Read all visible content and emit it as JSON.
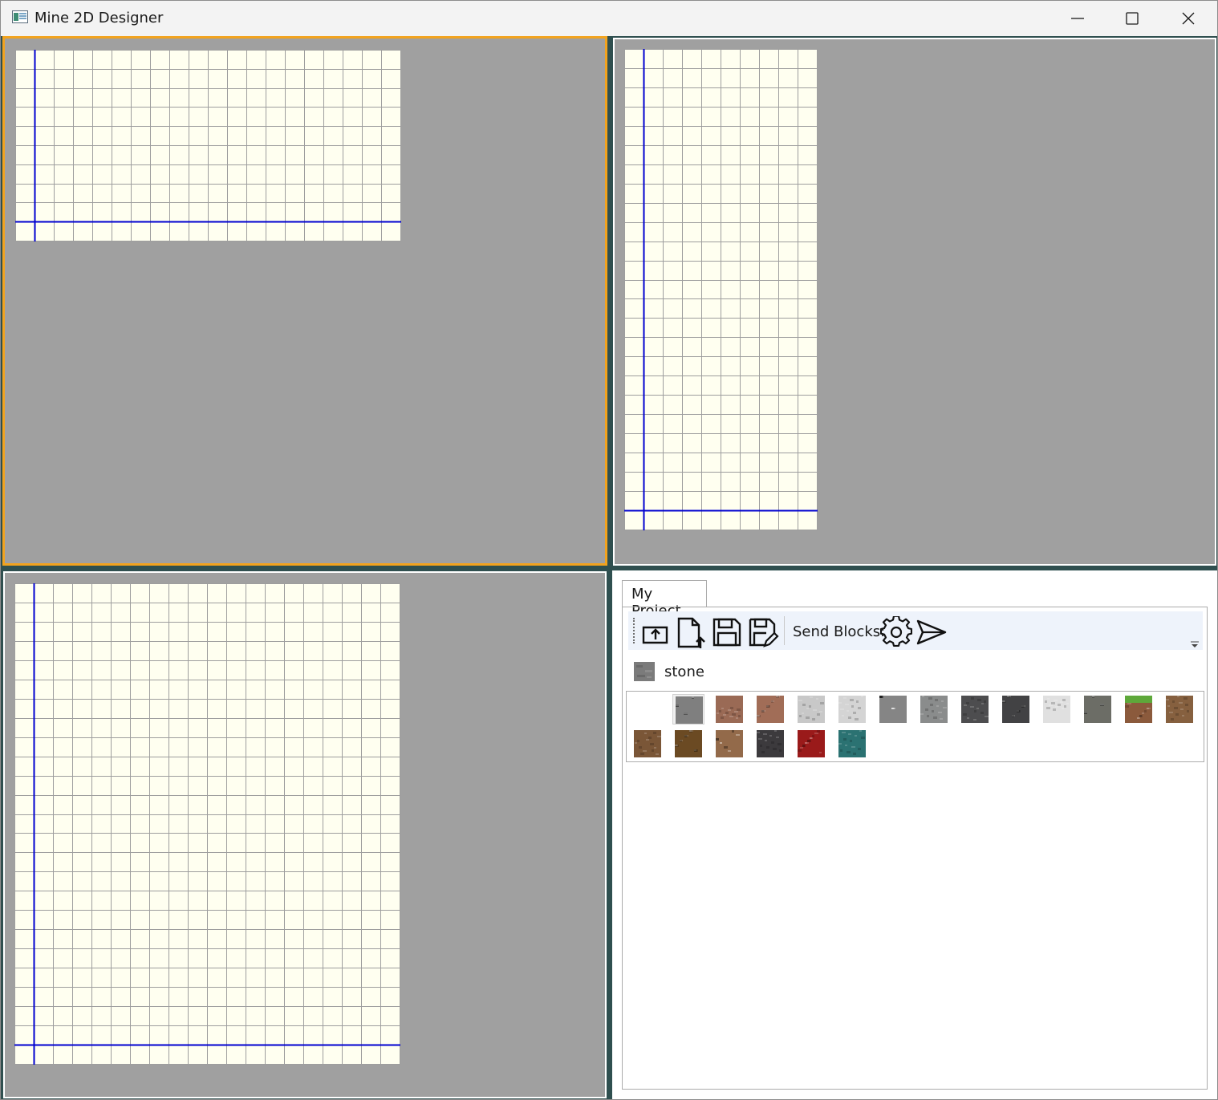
{
  "window": {
    "title": "Mine 2D Designer",
    "controls": [
      "minimize",
      "maximize",
      "close"
    ]
  },
  "colors": {
    "viewport_background": "#a0a0a0",
    "grid_paper": "#fffff0",
    "grid_line": "#9e9e9e",
    "axis_line": "#0000d0",
    "active_border": "#f2a31e",
    "splitter": "#2f4f4f"
  },
  "views": [
    {
      "name": "view-top-left",
      "active": true,
      "columns": 20,
      "rows": 10
    },
    {
      "name": "view-top-right",
      "active": false,
      "columns": 10,
      "rows": 25
    },
    {
      "name": "view-bottom-left",
      "active": false,
      "columns": 20,
      "rows": 25
    }
  ],
  "project": {
    "tab_label": "My Project",
    "toolbar": {
      "buttons": [
        "open-icon",
        "export-icon",
        "save-icon",
        "save-as-icon"
      ],
      "send_blocks_label": "Send Blocks:",
      "send_buttons": [
        "settings-gear-icon",
        "send-icon"
      ]
    },
    "selected_block": {
      "label": "stone",
      "color": "#7b7b7b"
    },
    "blocks": [
      {
        "name": "empty",
        "color": "#ffffff"
      },
      {
        "name": "stone",
        "color": "#7f7f7f",
        "selected": true
      },
      {
        "name": "granite",
        "color": "#9a6a55"
      },
      {
        "name": "polished-granite",
        "color": "#a16d57"
      },
      {
        "name": "diorite",
        "color": "#c8c8c8"
      },
      {
        "name": "polished-diorite",
        "color": "#d4d4d4"
      },
      {
        "name": "andesite",
        "color": "#858585"
      },
      {
        "name": "polished-andesite",
        "color": "#8a8c8c"
      },
      {
        "name": "deepslate",
        "color": "#4d4d4f"
      },
      {
        "name": "cobbled-deepslate",
        "color": "#424244"
      },
      {
        "name": "calcite",
        "color": "#e0e0e0"
      },
      {
        "name": "tuff",
        "color": "#6c6d66"
      },
      {
        "name": "grass-block",
        "color": "#8b5a3c",
        "top": "#5ea83a"
      },
      {
        "name": "dirt",
        "color": "#86603f"
      },
      {
        "name": "coarse-dirt",
        "color": "#7a5637"
      },
      {
        "name": "podzol",
        "color": "#6b4a23"
      },
      {
        "name": "rooted-dirt",
        "color": "#936a4a"
      },
      {
        "name": "mud",
        "color": "#3c3a3d"
      },
      {
        "name": "crimson-nylium",
        "color": "#9a1a1a"
      },
      {
        "name": "warped-nylium",
        "color": "#2b7272"
      }
    ]
  }
}
